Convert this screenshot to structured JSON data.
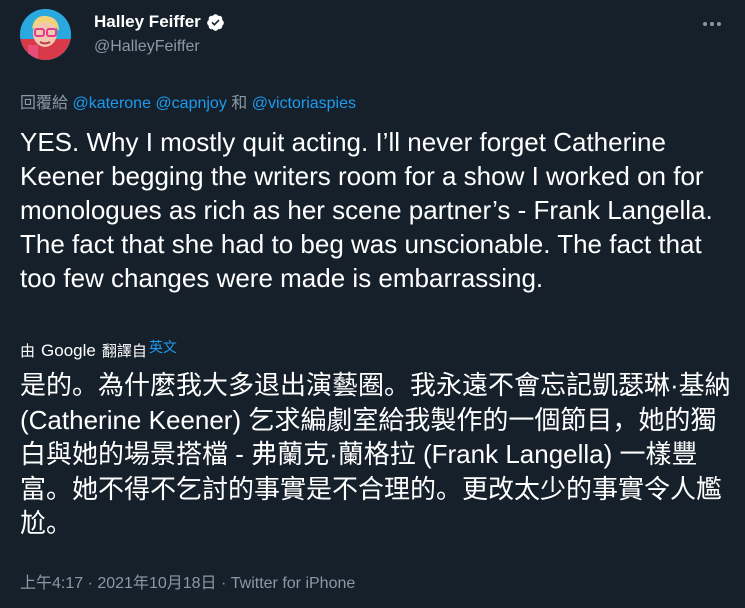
{
  "author": {
    "name": "Halley Feiffer",
    "handle": "@HalleyFeiffer",
    "verified": true
  },
  "reply": {
    "prefix": "回覆給 ",
    "mention1": "@katerone",
    "mention2": "@capnjoy",
    "joiner": " 和 ",
    "mention3": "@victoriaspies"
  },
  "tweet_text": "YES. Why I mostly quit acting. I’ll never forget Catherine Keener begging the writers room for a show I worked on for monologues as rich as her scene partner’s - Frank Langella. The fact that she had to beg was unscionable. The fact that too few changes were made is embarrassing.",
  "translation": {
    "by_prefix": "由",
    "provider": "Google",
    "by_suffix": "翻譯自",
    "source_language": "英文",
    "text": "是的。為什麼我大多退出演藝圈。我永遠不會忘記凱瑟琳·基納 (Catherine Keener) 乞求編劇室給我製作的一個節目，她的獨白與她的場景搭檔 - 弗蘭克·蘭格拉 (Frank Langella) 一樣豐富。她不得不乞討的事實是不合理的。更改太少的事實令人尷尬。"
  },
  "meta": "上午4:17 · 2021年10月18日 · Twitter for iPhone",
  "colors": {
    "background": "#15202b",
    "text": "#ffffff",
    "secondary": "#8b98a5",
    "link": "#1d9bf0"
  },
  "icons": [
    "verified-badge-icon",
    "more-options-icon"
  ]
}
